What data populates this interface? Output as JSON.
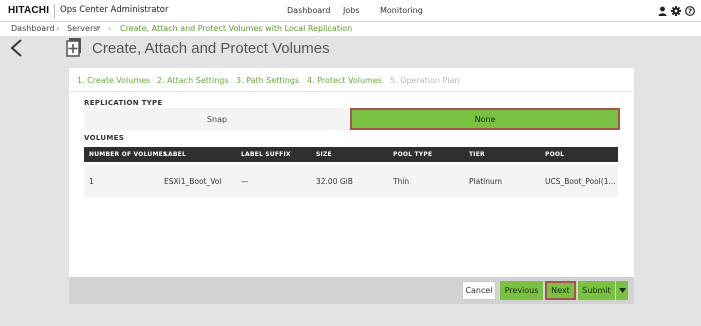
{
  "header": {
    "brand": "HITACHI",
    "app_name": "Ops Center Administrator",
    "nav": [
      "Dashboard",
      "Jobs",
      "Monitoring"
    ],
    "icons": [
      "user-icon",
      "gear-icon",
      "help-icon"
    ]
  },
  "breadcrumb": {
    "items": [
      "Dashboard",
      "Servers",
      "Create, Attach and Protect Volumes with Local Replication"
    ]
  },
  "page": {
    "title": "Create, Attach and Protect Volumes"
  },
  "steps": [
    {
      "label": "1. Create Volumes",
      "state": "done"
    },
    {
      "label": "2. Attach Settings",
      "state": "done"
    },
    {
      "label": "3. Path Settings",
      "state": "done"
    },
    {
      "label": "4. Protect Volumes",
      "state": "current"
    },
    {
      "label": "5. Operation Plan",
      "state": "disabled"
    }
  ],
  "replication": {
    "label": "REPLICATION TYPE",
    "options": [
      "Snap",
      "None"
    ],
    "selected": "None"
  },
  "volumes": {
    "label": "VOLUMES",
    "columns": [
      "NUMBER OF VOLUMES",
      "LABEL",
      "LABEL SUFFIX",
      "SIZE",
      "POOL TYPE",
      "TIER",
      "POOL"
    ],
    "rows": [
      [
        "1",
        "ESXi1_Boot_Vol",
        "—",
        "32.00 GiB",
        "Thin",
        "Platinum",
        "UCS_Boot_Pool(1..."
      ]
    ]
  },
  "footer": {
    "cancel": "Cancel",
    "previous": "Previous",
    "next": "Next",
    "submit": "Submit"
  },
  "colors": {
    "accent": "#7ac143",
    "highlight_border": "#a8534a",
    "table_header": "#2f2f2f",
    "step_text": "#6aa83b"
  }
}
